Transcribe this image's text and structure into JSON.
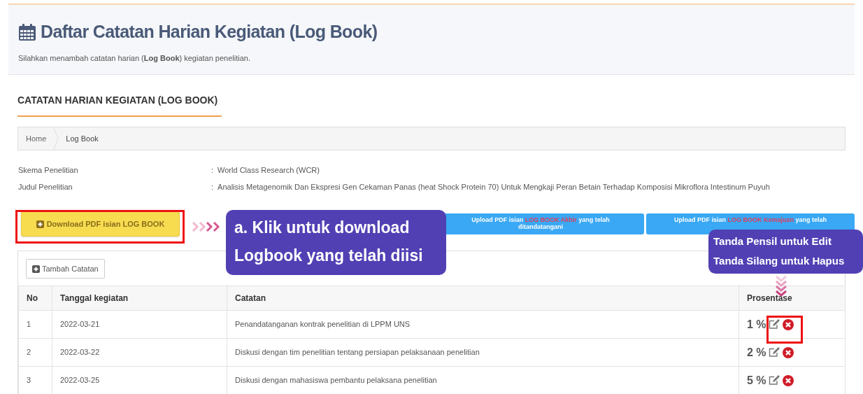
{
  "header": {
    "title": "Daftar Catatan Harian Kegiatan (Log Book)",
    "subtitle": "Silahkan menambah catatan harian (**Log Book**) kegiatan penelitian."
  },
  "section_title": "CATATAN HARIAN KEGIATAN (LOG BOOK)",
  "breadcrumb": [
    "Home",
    "Log Book"
  ],
  "info": [
    {
      "label": "Skema Penelitian",
      "separator": ":",
      "value": "World Class Research (WCR)"
    },
    {
      "label": "Judul Penelitian",
      "separator": ":",
      "value": "Analisis Metagenomik Dan Ekspresi Gen Cekaman Panas (heat Shock Protein 70) Untuk Mengkaji Peran Betain Terhadap Komposisi Mikroflora Intestinum Puyuh"
    }
  ],
  "buttons": [
    {
      "kind": "download",
      "before": "Download PDF isian LOG BOOK"
    },
    {
      "kind": "upload",
      "before": "Upload PDF isian ",
      "highlight": "LOG BOOK Akhir",
      "after": " yang telah ditandatangani"
    },
    {
      "kind": "upload",
      "before": "Upload PDF isian ",
      "highlight": "LOG BOOK Kemajuan",
      "after": " yang telah"
    }
  ],
  "table": {
    "add_button": "Tambah Catatan",
    "columns": [
      "No",
      "Tanggal kegiatan",
      "Catatan",
      "Prosentase"
    ],
    "rows": [
      {
        "no": "1",
        "date": "2022-03-21",
        "note": "Penandatanganan kontrak penelitian di LPPM UNS",
        "percent": "1 %"
      },
      {
        "no": "2",
        "date": "2022-03-22",
        "note": "Diskusi dengan tim penelitian tentang persiapan pelaksanaan penelitian",
        "percent": "2 %"
      },
      {
        "no": "3",
        "date": "2022-03-25",
        "note": "Diskusi dengan mahasiswa pembantu pelaksana penelitian",
        "percent": "5 %"
      }
    ]
  },
  "annotations": [
    {
      "kind": "callout_download",
      "lines": [
        "a. Klik untuk download",
        "Logbook yang telah diisi"
      ]
    },
    {
      "kind": "callout_actions",
      "lines": [
        "Tanda Pensil untuk Edit",
        "Tanda Silang untuk Hapus"
      ]
    }
  ]
}
